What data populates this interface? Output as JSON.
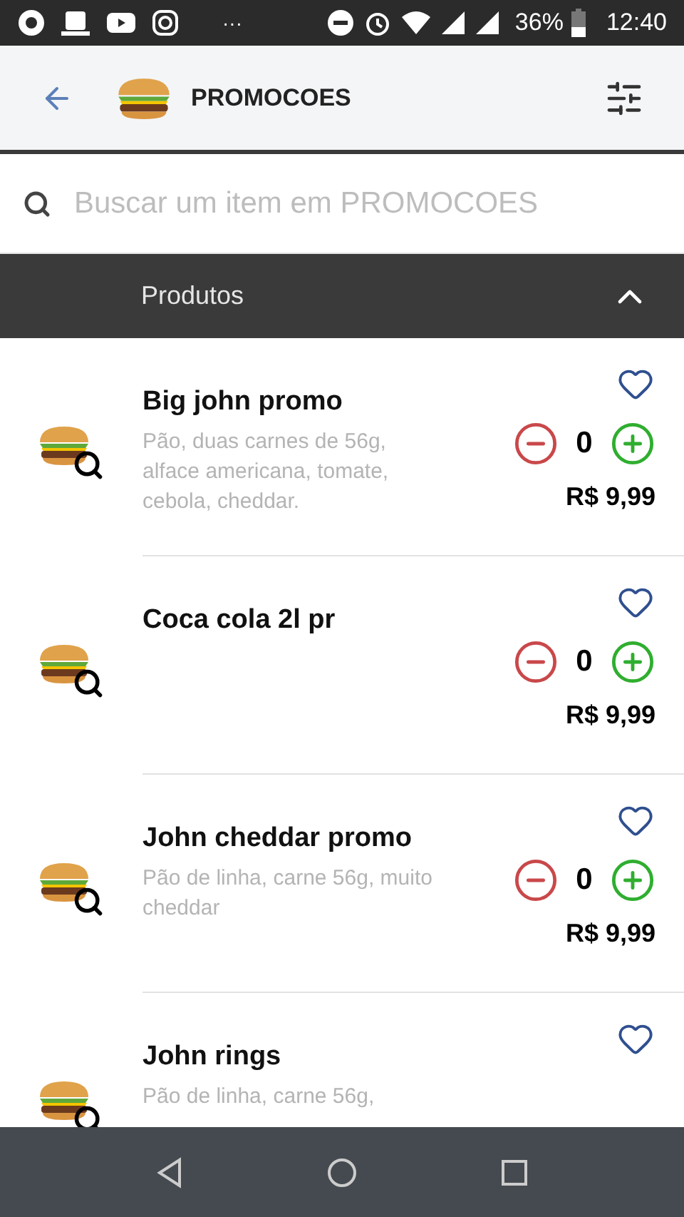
{
  "status_bar": {
    "more": "···",
    "battery": "36%",
    "time": "12:40"
  },
  "header": {
    "title": "PROMOCOES"
  },
  "search": {
    "placeholder": "Buscar um item em PROMOCOES"
  },
  "section": {
    "title": "Produtos",
    "expanded": true
  },
  "products": [
    {
      "name": "Big john promo",
      "description": "Pão, duas carnes de 56g, alface americana, tomate, cebola, cheddar.",
      "quantity": "0",
      "price": "R$ 9,99",
      "favorite": false
    },
    {
      "name": "Coca cola 2l pr",
      "quantity": "0",
      "price": "R$ 9,99",
      "favorite": false
    },
    {
      "name": "John cheddar promo",
      "description": "Pão de linha, carne 56g, muito cheddar",
      "quantity": "0",
      "price": "R$ 9,99",
      "favorite": false
    },
    {
      "name": "John rings",
      "description": "Pão de linha, carne 56g,",
      "favorite": false
    }
  ]
}
